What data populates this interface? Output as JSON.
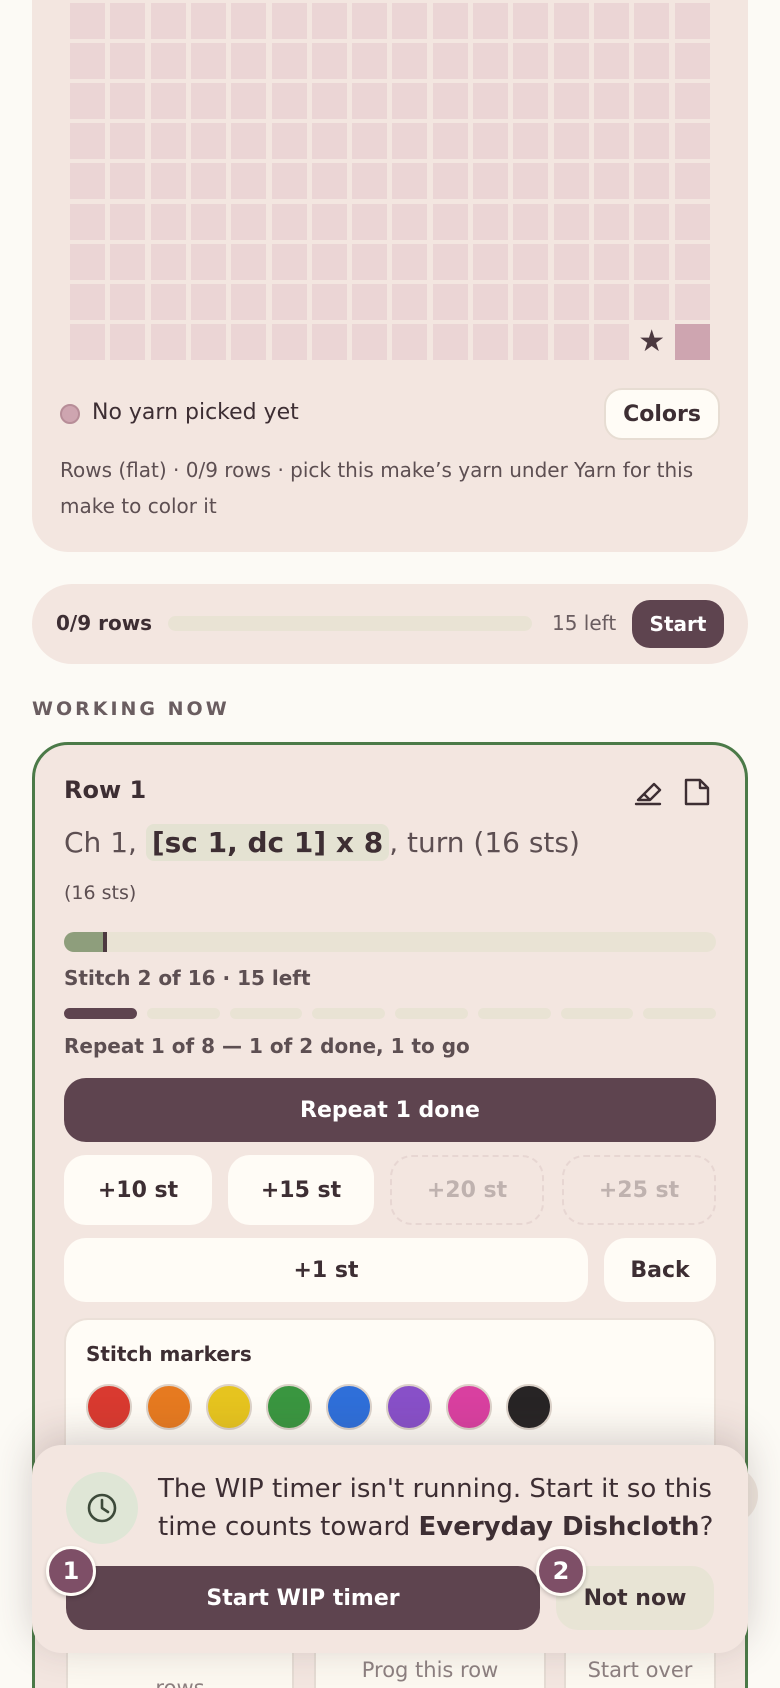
{
  "chart": {
    "columns": 16,
    "rows": 9,
    "filled_cell": {
      "row": 9,
      "column": 16
    },
    "start_marker_icon": "star-icon",
    "yarn_status": "No yarn picked yet",
    "colors_button": "Colors",
    "note": "Rows (flat) · 0/9 rows · pick this make’s yarn under Yarn for this make to color it"
  },
  "progress": {
    "rows_label": "0/9 rows",
    "fraction_complete": 0,
    "left_label": "15 left",
    "start_button": "Start"
  },
  "section_label": "WORKING NOW",
  "working": {
    "row_title": "Row 1",
    "instruction_before": "Ch 1, ",
    "instruction_highlight": "[sc 1, dc 1] x 8",
    "instruction_after": ", turn (16 sts)",
    "stitch_count": "(16 sts)",
    "stitch_progress": {
      "current": 2,
      "total": 16
    },
    "stitch_label": "Stitch 2 of 16 · 15 left",
    "repeat_progress": {
      "done": 1,
      "total": 8
    },
    "repeat_label": "Repeat 1 of 8 — 1 of 2 done, 1 to go",
    "repeat_button": "Repeat 1 done",
    "increments": [
      {
        "label": "+10 st",
        "enabled": true
      },
      {
        "label": "+15 st",
        "enabled": true
      },
      {
        "label": "+20 st",
        "enabled": false
      },
      {
        "label": "+25 st",
        "enabled": false
      }
    ],
    "plus_one": "+1 st",
    "back": "Back",
    "markers_title": "Stitch markers",
    "marker_colors": [
      "#d93a30",
      "#e67a20",
      "#e6c41f",
      "#3a9640",
      "#2f6fd9",
      "#8850c8",
      "#d940a0",
      "#272425"
    ],
    "bottom_buttons": [
      "rows",
      "Prog this row",
      "Start over"
    ]
  },
  "popup": {
    "message_before": "The WIP timer isn't running. Start it so this time counts toward ",
    "project_name": "Everyday Dishcloth",
    "message_after": "?",
    "start_button": "Start WIP timer",
    "dismiss_button": "Not now",
    "badges": [
      "1",
      "2"
    ]
  },
  "colors": {
    "accent": "#5e444f",
    "card": "#f3e6e0",
    "active_border": "#4b7a48",
    "cell": "#ebd5d5",
    "cell_filled": "#cea5b0"
  }
}
